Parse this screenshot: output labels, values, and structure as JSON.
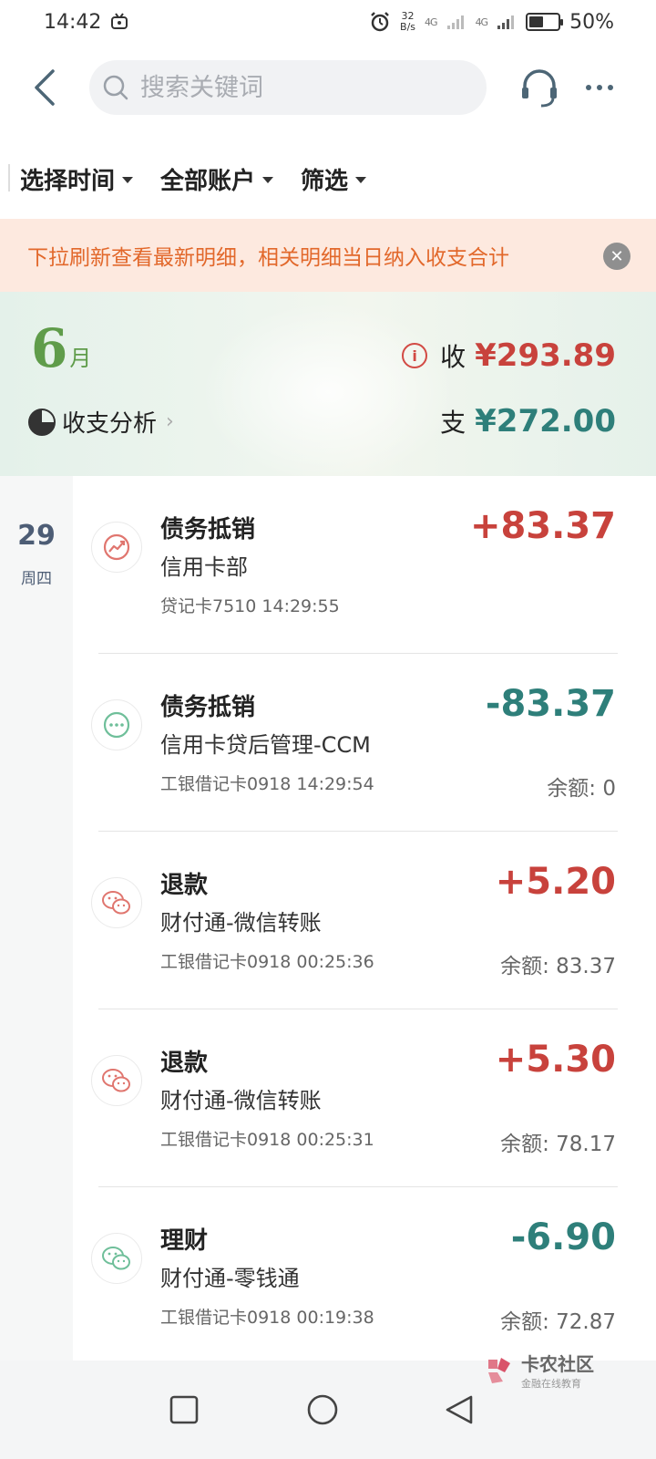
{
  "status_bar": {
    "time": "14:42",
    "net_speed_value": "32",
    "net_speed_unit": "B/s",
    "signal1": "4G",
    "signal2": "4G",
    "battery": "50%",
    "battery_level": 0.5
  },
  "header": {
    "search_placeholder": "搜索关键词"
  },
  "filters": [
    {
      "label": "选择时间"
    },
    {
      "label": "全部账户"
    },
    {
      "label": "筛选"
    }
  ],
  "notice": {
    "text": "下拉刷新查看最新明细，相关明细当日纳入收支合计"
  },
  "summary": {
    "month_number": "6",
    "month_unit": "月",
    "analysis_label": "收支分析",
    "income_label": "收",
    "income_amount": "¥293.89",
    "expense_label": "支",
    "expense_amount": "¥272.00"
  },
  "date_group": {
    "day": "29",
    "weekday": "周四"
  },
  "transactions": [
    {
      "title": "债务抵销",
      "counterparty": "信用卡部",
      "meta": "贷记卡7510  14:29:55",
      "amount": "+83.37",
      "balance": "",
      "icon": "trend-icon",
      "icon_color": "#e0766f"
    },
    {
      "title": "债务抵销",
      "counterparty": "信用卡贷后管理-CCM",
      "meta": "工银借记卡0918  14:29:54",
      "amount": "-83.37",
      "balance": "余额: 0",
      "icon": "more-dots-icon",
      "icon_color": "#6fbf9a"
    },
    {
      "title": "退款",
      "counterparty": "财付通-微信转账",
      "meta": "工银借记卡0918  00:25:36",
      "amount": "+5.20",
      "balance": "余额: 83.37",
      "icon": "wechat-icon",
      "icon_color": "#e0766f"
    },
    {
      "title": "退款",
      "counterparty": "财付通-微信转账",
      "meta": "工银借记卡0918  00:25:31",
      "amount": "+5.30",
      "balance": "余额: 78.17",
      "icon": "wechat-icon",
      "icon_color": "#e0766f"
    },
    {
      "title": "理财",
      "counterparty": "财付通-零钱通",
      "meta": "工银借记卡0918  00:19:38",
      "amount": "-6.90",
      "balance": "余额: 72.87",
      "icon": "wechat-icon",
      "icon_color": "#6fbf9a"
    }
  ],
  "watermark": {
    "main": "卡农社区",
    "sub": "金融在线教育"
  },
  "colors": {
    "income": "#c8423c",
    "expense": "#2e7f7a",
    "notice_bg": "#fde9df",
    "notice_text": "#e2682b"
  }
}
